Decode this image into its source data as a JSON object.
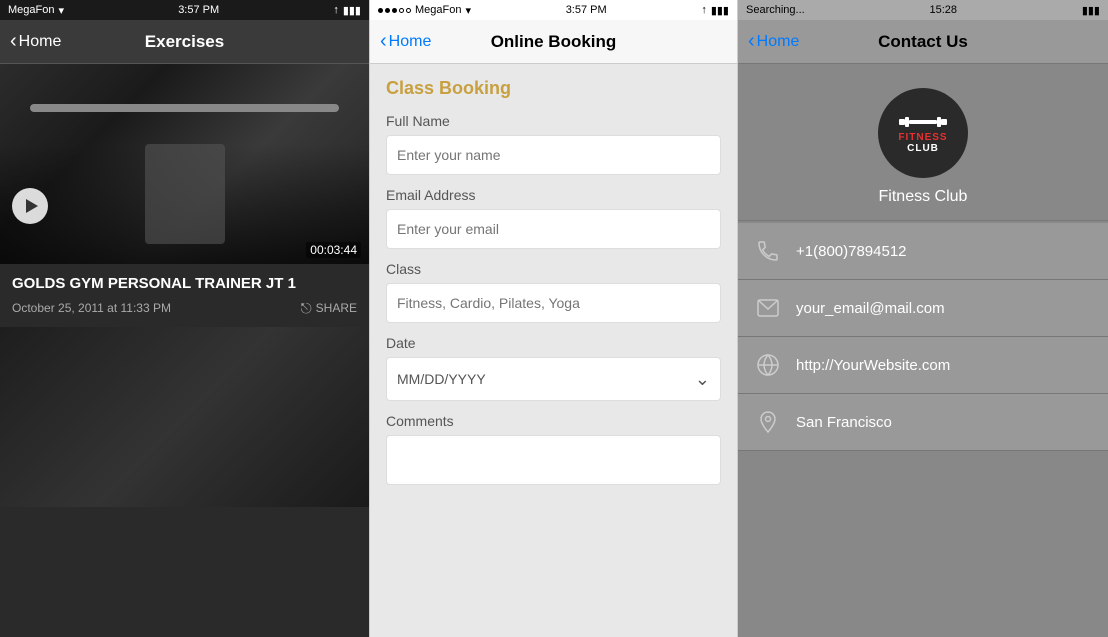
{
  "panel1": {
    "status": {
      "carrier": "MegaFon",
      "time": "3:57 PM",
      "wifi": true
    },
    "nav": {
      "back_label": "Home",
      "title": "Exercises"
    },
    "video1": {
      "duration": "00:03:44",
      "title": "GOLDS GYM PERSONAL TRAINER JT 1",
      "date": "October 25, 2011 at 11:33 PM",
      "share_label": "SHARE"
    }
  },
  "panel2": {
    "status": {
      "carrier": "MegaFon",
      "time": "3:57 PM"
    },
    "nav": {
      "back_label": "Home",
      "title": "Online Booking"
    },
    "form": {
      "section_title": "Class Booking",
      "full_name_label": "Full Name",
      "full_name_placeholder": "Enter your name",
      "email_label": "Email Address",
      "email_placeholder": "Enter your email",
      "class_label": "Class",
      "class_placeholder": "Fitness, Cardio, Pilates, Yoga",
      "date_label": "Date",
      "date_placeholder": "MM/DD/YYYY",
      "comments_label": "Comments"
    }
  },
  "panel3": {
    "status": {
      "carrier": "Searching...",
      "time": "15:28"
    },
    "nav": {
      "back_label": "Home",
      "title": "Contact Us"
    },
    "logo": {
      "text_fitness": "FITNESS",
      "text_club": "CLUB",
      "club_name": "Fitness Club"
    },
    "contacts": [
      {
        "type": "phone",
        "value": "+1(800)7894512",
        "icon": "phone-icon"
      },
      {
        "type": "email",
        "value": "your_email@mail.com",
        "icon": "email-icon"
      },
      {
        "type": "website",
        "value": "http://YourWebsite.com",
        "icon": "website-icon"
      },
      {
        "type": "location",
        "value": "San Francisco",
        "icon": "location-icon"
      }
    ]
  }
}
